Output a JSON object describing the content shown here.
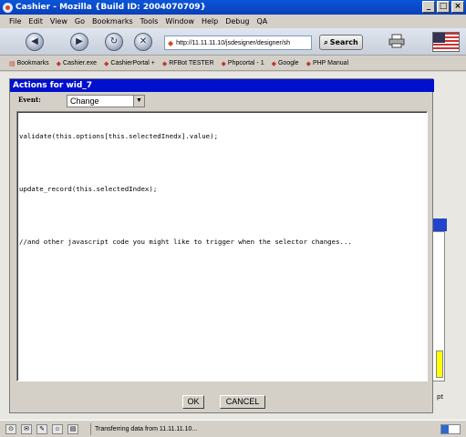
{
  "window": {
    "title": "Cashier - Mozilla {Build ID: 2004070709}",
    "controls": [
      "_",
      "□",
      "×"
    ]
  },
  "menu": [
    "File",
    "Edit",
    "View",
    "Go",
    "Bookmarks",
    "Tools",
    "Window",
    "Help",
    "Debug",
    "QA"
  ],
  "toolbar": {
    "url": "http://11.11.11.10/jsdesigner/designer/sh",
    "search_label": "Search"
  },
  "bookmarks": [
    {
      "label": "Bookmarks"
    },
    {
      "label": "Cashier.exe"
    },
    {
      "label": "CashierPortal +"
    },
    {
      "label": "RFBot TESTER"
    },
    {
      "label": "Phpcortal - 1"
    },
    {
      "label": "Google"
    },
    {
      "label": "PHP Manual"
    }
  ],
  "dialog": {
    "title": "Actions for wid_7",
    "event_label": "Event:",
    "event_value": "Change",
    "code": [
      "validate(this.options[this.selectedInedx].value);",
      "",
      "update_record(this.selectedIndex);",
      "",
      "//and other javascript code you might like to trigger when the selector changes..."
    ],
    "ok_label": "OK",
    "cancel_label": "CANCEL"
  },
  "background": {
    "pt_label": "pt"
  },
  "status": {
    "text": "Transferring data from 11.11.11.10...",
    "progress": 0.4
  }
}
